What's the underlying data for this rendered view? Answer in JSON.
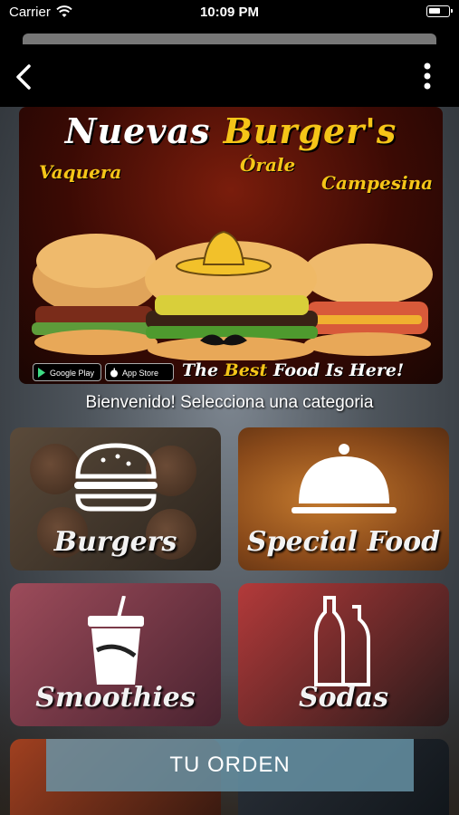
{
  "status_bar": {
    "carrier": "Carrier",
    "time": "10:09 PM"
  },
  "nav": {
    "back_icon": "chevron-left-icon",
    "menu_icon": "more-vertical-icon"
  },
  "banner": {
    "title_part1": "Nuevas ",
    "title_part2": "Burger's",
    "flavors": [
      "Vaquera",
      "Órale",
      "Campesina"
    ],
    "google_play": "Google Play",
    "app_store": "App Store",
    "tagline_pre": "The ",
    "tagline_accent": "Best",
    "tagline_post": " Food Is Here!"
  },
  "welcome": "Bienvenido! Selecciona una categoria",
  "categories": [
    {
      "label": "Burgers",
      "icon": "burger-icon"
    },
    {
      "label": "Special Food",
      "icon": "cloche-icon"
    },
    {
      "label": "Smoothies",
      "icon": "cup-icon"
    },
    {
      "label": "Sodas",
      "icon": "bottles-icon"
    }
  ],
  "order_button": "TU ORDEN",
  "colors": {
    "accent": "#f5c518",
    "order_button": "#6996aa"
  }
}
